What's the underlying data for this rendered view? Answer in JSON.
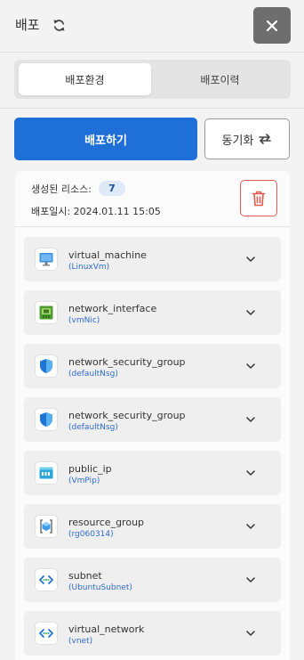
{
  "header": {
    "title": "배포",
    "refresh_icon": "refresh-icon",
    "close_icon": "close-icon"
  },
  "tabs": [
    {
      "label": "배포환경",
      "active": true
    },
    {
      "label": "배포이력",
      "active": false
    }
  ],
  "actions": {
    "deploy_label": "배포하기",
    "sync_label": "동기화",
    "sync_icon": "sync-arrows-icon"
  },
  "info": {
    "resources_label": "생성된 리소스:",
    "resources_count": "7",
    "deployed_at": "배포일시: 2024.01.11 15:05",
    "delete_icon": "trash-icon"
  },
  "resources": [
    {
      "type": "virtual_machine",
      "name": "(LinuxVm)",
      "icon": "monitor-icon"
    },
    {
      "type": "network_interface",
      "name": "(vmNic)",
      "icon": "network-card-icon"
    },
    {
      "type": "network_security_group",
      "name": "(defaultNsg)",
      "icon": "shield-icon"
    },
    {
      "type": "network_security_group",
      "name": "(defaultNsg)",
      "icon": "shield-icon"
    },
    {
      "type": "public_ip",
      "name": "(VmPip)",
      "icon": "public-ip-icon"
    },
    {
      "type": "resource_group",
      "name": "(rg060314)",
      "icon": "resource-group-icon"
    },
    {
      "type": "subnet",
      "name": "(UbuntuSubnet)",
      "icon": "subnet-icon"
    },
    {
      "type": "virtual_network",
      "name": "(vnet)",
      "icon": "virtual-network-icon"
    }
  ],
  "colors": {
    "primary": "#1f6fd8",
    "danger": "#e05a52",
    "link": "#2f6bc7",
    "badge_bg": "#dfeaf8"
  }
}
